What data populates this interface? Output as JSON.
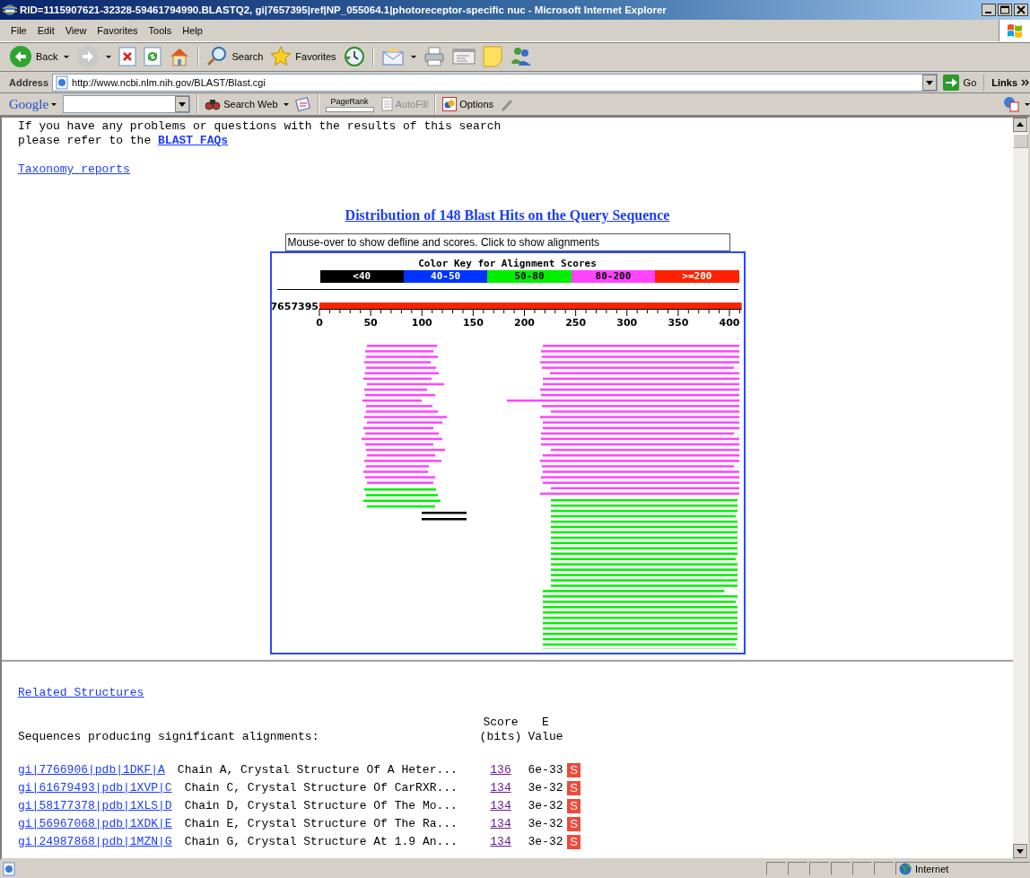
{
  "window": {
    "title": "RID=1115907621-32328-59461794990.BLASTQ2, gi|7657395|ref|NP_055064.1|photoreceptor-specific nuc - Microsoft Internet Explorer"
  },
  "menu": [
    "File",
    "Edit",
    "View",
    "Favorites",
    "Tools",
    "Help"
  ],
  "toolbar": {
    "back_label": "Back",
    "search_label": "Search",
    "favorites_label": "Favorites"
  },
  "address_bar": {
    "label": "Address",
    "url": "http://www.ncbi.nlm.nih.gov/BLAST/Blast.cgi",
    "go_label": "Go",
    "links_label": "Links"
  },
  "google_bar": {
    "logo": "Google",
    "search_web_label": "Search Web",
    "pagerank_label": "PageRank",
    "autofill_label": "AutoFill",
    "options_label": "Options"
  },
  "content": {
    "intro": "If you have any problems or questions with the results of this search\nplease refer to the",
    "faq_link": "BLAST FAQs",
    "taxonomy_link": "Taxonomy reports",
    "distribution_title": "Distribution of 148 Blast Hits on the Query Sequence",
    "mouseover_field": {
      "value": "Mouse-over to show defline and scores. Click to show alignments"
    }
  },
  "graphic": {
    "key_title": "Color Key for Alignment Scores",
    "color_key": [
      {
        "label": "<40",
        "color": "#000000"
      },
      {
        "label": "40-50",
        "color": "#0033ff"
      },
      {
        "label": "50-80",
        "color": "#00ee00"
      },
      {
        "label": "80-200",
        "color": "#ff44ff"
      },
      {
        "label": ">=200",
        "color": "#ff2200"
      }
    ],
    "query_label": "7657395",
    "axis_ticks": [
      "0",
      "50",
      "100",
      "150",
      "200",
      "250",
      "300",
      "350",
      "400"
    ]
  },
  "related_structures_link": "Related Structures",
  "table": {
    "heading": "Sequences producing significant alignments:",
    "score_header": [
      "Score",
      "(bits)"
    ],
    "evalue_header": [
      "E",
      "Value"
    ],
    "rows": [
      {
        "id": "gi|7766906|pdb|1DKF|A",
        "description": "Chain A, Crystal Structure Of A Heter...",
        "score": "136",
        "evalue": "6e-33",
        "badge": "S"
      },
      {
        "id": "gi|61679493|pdb|1XVP|C",
        "description": "Chain C, Crystal Structure Of CarRXR...",
        "score": "134",
        "evalue": "3e-32",
        "badge": "S"
      },
      {
        "id": "gi|58177378|pdb|1XLS|D",
        "description": "Chain D, Crystal Structure Of The Mo...",
        "score": "134",
        "evalue": "3e-32",
        "badge": "S"
      },
      {
        "id": "gi|56967068|pdb|1XDK|E",
        "description": "Chain E, Crystal Structure Of The Ra...",
        "score": "134",
        "evalue": "3e-32",
        "badge": "S"
      },
      {
        "id": "gi|24987868|pdb|1MZN|G",
        "description": "Chain G, Crystal Structure At 1.9 An...",
        "score": "134",
        "evalue": "3e-32",
        "badge": "S"
      }
    ]
  },
  "status_bar": {
    "zone": "Internet"
  }
}
